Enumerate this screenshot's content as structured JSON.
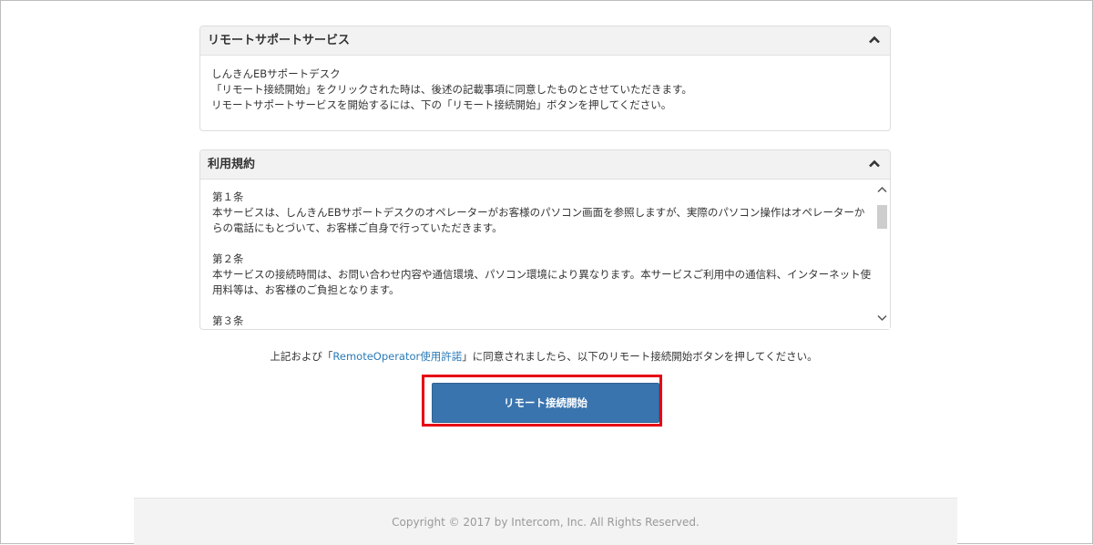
{
  "remote_support": {
    "title": "リモートサポートサービス",
    "lines": [
      "しんきんEBサポートデスク",
      "「リモート接続開始」をクリックされた時は、後述の記載事項に同意したものとさせていただきます。",
      "リモートサポートサービスを開始するには、下の「リモート接続開始」ボタンを押してください。"
    ]
  },
  "terms": {
    "title": "利用規約",
    "articles": [
      {
        "heading": "第１条",
        "text": "本サービスは、しんきんEBサポートデスクのオペレーターがお客様のパソコン画面を参照しますが、実際のパソコン操作はオペレーターからの電話にもとづいて、お客様ご自身で行っていただきます。"
      },
      {
        "heading": "第２条",
        "text": "本サービスの接続時間は、お問い合わせ内容や通信環境、パソコン環境により異なります。本サービスご利用中の通信料、インターネット使用料等は、お客様のご負担となります。"
      },
      {
        "heading": "第３条",
        "text": ""
      }
    ]
  },
  "consent": {
    "prefix": "上記および「",
    "link_text": "RemoteOperator使用許諾",
    "suffix": "」に同意されましたら、以下のリモート接続開始ボタンを押してください。"
  },
  "start_button_label": "リモート接続開始",
  "footer": {
    "copyright": "Copyright © 2017 by Intercom, Inc. All Rights Reserved."
  },
  "colors": {
    "button": "#3a74ae",
    "highlight": "#e60012",
    "link": "#2a7ab8"
  }
}
